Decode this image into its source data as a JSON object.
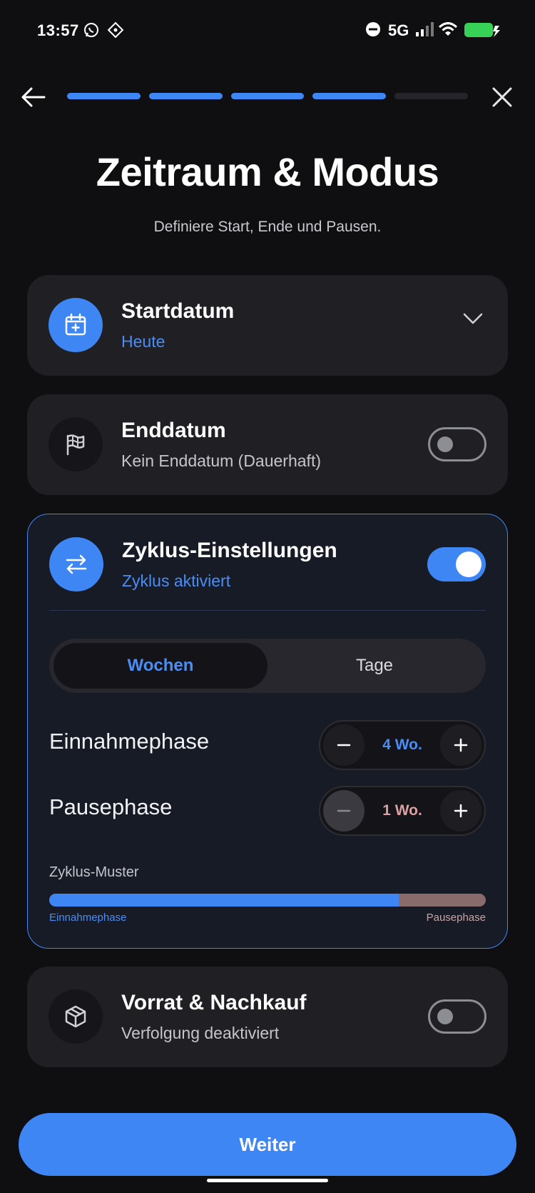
{
  "status_bar": {
    "time": "13:57",
    "network": "5G",
    "icons": [
      "whatsapp-icon",
      "app-icon",
      "dnd-icon",
      "signal-icon",
      "wifi-icon",
      "battery-charging-icon"
    ]
  },
  "header": {
    "progress_total": 5,
    "progress_completed": 4
  },
  "title": "Zeitraum & Modus",
  "subtitle": "Definiere Start, Ende und Pausen.",
  "start_card": {
    "title": "Startdatum",
    "value": "Heute"
  },
  "end_card": {
    "title": "Enddatum",
    "value": "Kein Enddatum (Dauerhaft)",
    "enabled": false
  },
  "cycle_card": {
    "title": "Zyklus-Einstellungen",
    "status": "Zyklus aktiviert",
    "enabled": true,
    "unit_options": [
      "Wochen",
      "Tage"
    ],
    "selected_unit": "Wochen",
    "intake_label": "Einnahmephase",
    "intake_value": "4 Wo.",
    "pause_label": "Pausephase",
    "pause_value": "1 Wo.",
    "pattern_title": "Zyklus-Muster",
    "pattern_intake_weeks": 4,
    "pattern_pause_weeks": 1,
    "legend_intake": "Einnahmephase",
    "legend_pause": "Pausephase"
  },
  "stock_card": {
    "title": "Vorrat & Nachkauf",
    "value": "Verfolgung deaktiviert",
    "enabled": false
  },
  "next_button": "Weiter",
  "colors": {
    "accent": "#3f86f5",
    "background": "#0f0f11",
    "card": "#1f1f24",
    "pause": "#8a6b6b"
  }
}
